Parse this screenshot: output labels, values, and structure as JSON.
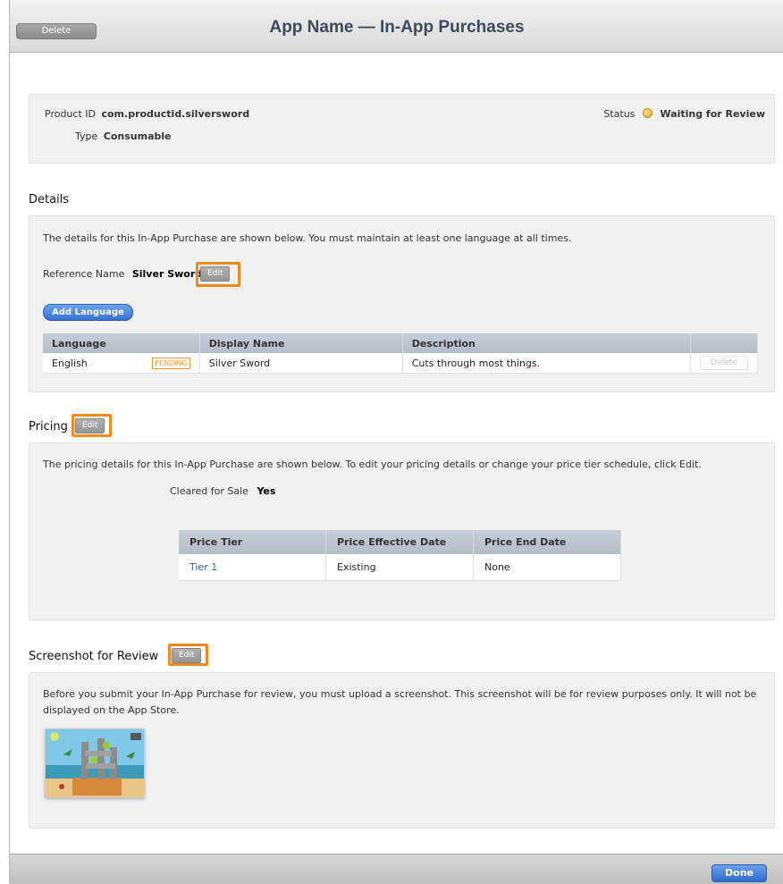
{
  "window": {
    "title": "App Name — In-App Purchases",
    "delete_label": "Delete",
    "done_label": "Done"
  },
  "summary": {
    "product_id_label": "Product ID",
    "product_id": "com.productid.silversword",
    "type_label": "Type",
    "type": "Consumable",
    "status_label": "Status",
    "status": "Waiting for Review",
    "status_color": "#f0a81e"
  },
  "details": {
    "heading": "Details",
    "description": "The details for this In-App Purchase are shown below. You must maintain at least one language at all times.",
    "reference_name_label": "Reference Name",
    "reference_name": "Silver Sword",
    "edit_label": "Edit",
    "add_language_label": "Add Language",
    "columns": [
      "Language",
      "Display Name",
      "Description",
      ""
    ],
    "rows": [
      {
        "language": "English",
        "badge": "PENDING",
        "display_name": "Silver Sword",
        "description": "Cuts through most things.",
        "action": "Delete"
      }
    ]
  },
  "pricing": {
    "heading": "Pricing",
    "edit_label": "Edit",
    "description": "The pricing details for this In-App Purchase are shown below. To edit your pricing details or change your price tier schedule, click Edit.",
    "cleared_label": "Cleared for Sale",
    "cleared_value": "Yes",
    "columns": [
      "Price Tier",
      "Price Effective Date",
      "Price End Date"
    ],
    "rows": [
      {
        "tier": "Tier 1",
        "effective": "Existing",
        "end": "None"
      }
    ]
  },
  "screenshot": {
    "heading": "Screenshot for Review",
    "edit_label": "Edit",
    "description": "Before you submit your In-App Purchase for review, you must upload a screenshot. This screenshot will be for review purposes only. It will not be displayed on the App Store."
  },
  "colors": {
    "highlight": "#f08a1c",
    "accent_blue": "#3672d1",
    "link": "#2e6bb5"
  }
}
